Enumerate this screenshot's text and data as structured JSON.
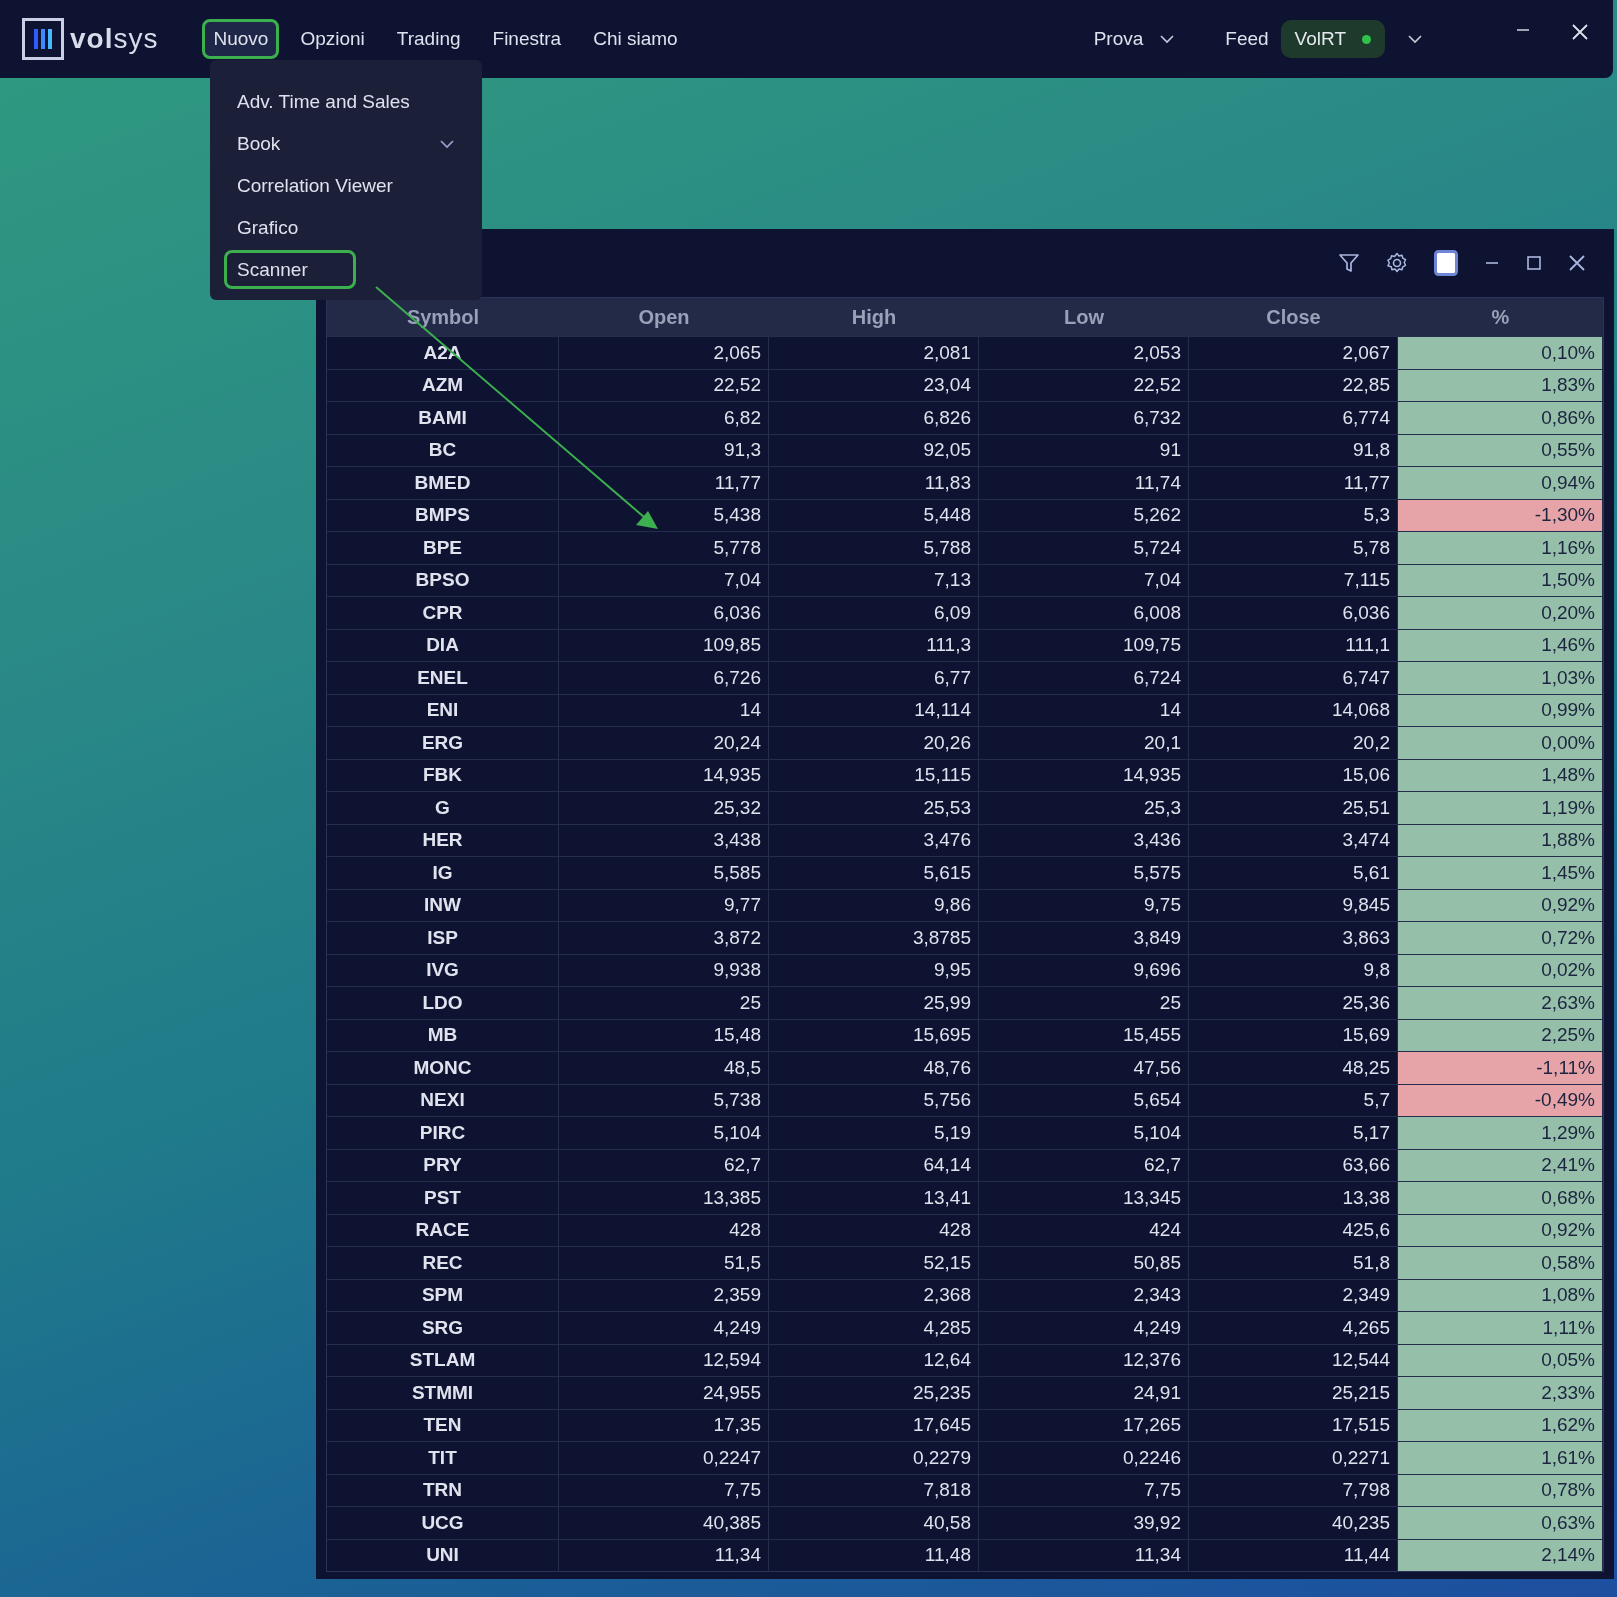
{
  "app": {
    "logo_text": "**vol**sys"
  },
  "menubar": [
    {
      "label": "Nuovo",
      "selected": true
    },
    {
      "label": "Opzioni",
      "selected": false
    },
    {
      "label": "Trading",
      "selected": false
    },
    {
      "label": "Finestra",
      "selected": false
    },
    {
      "label": "Chi siamo",
      "selected": false
    }
  ],
  "profile": {
    "label": "Prova"
  },
  "feed": {
    "label": "Feed",
    "source": "VolRT",
    "connected": true
  },
  "dropdown": [
    {
      "label": "Adv. Time and Sales",
      "kind": "item",
      "selected": false
    },
    {
      "label": "Book",
      "kind": "submenu",
      "selected": false
    },
    {
      "label": "Correlation Viewer",
      "kind": "item",
      "selected": false
    },
    {
      "label": "Grafico",
      "kind": "item",
      "selected": false
    },
    {
      "label": "Scanner",
      "kind": "item",
      "selected": true
    }
  ],
  "scanner": {
    "columns": [
      "Symbol",
      "Open",
      "High",
      "Low",
      "Close",
      "%"
    ],
    "rows": [
      {
        "cells": [
          "A2A",
          "2,065",
          "2,081",
          "2,053",
          "2,067",
          "0,10%"
        ],
        "negative": false
      },
      {
        "cells": [
          "AZM",
          "22,52",
          "23,04",
          "22,52",
          "22,85",
          "1,83%"
        ],
        "negative": false
      },
      {
        "cells": [
          "BAMI",
          "6,82",
          "6,826",
          "6,732",
          "6,774",
          "0,86%"
        ],
        "negative": false
      },
      {
        "cells": [
          "BC",
          "91,3",
          "92,05",
          "91",
          "91,8",
          "0,55%"
        ],
        "negative": false
      },
      {
        "cells": [
          "BMED",
          "11,77",
          "11,83",
          "11,74",
          "11,77",
          "0,94%"
        ],
        "negative": false
      },
      {
        "cells": [
          "BMPS",
          "5,438",
          "5,448",
          "5,262",
          "5,3",
          "-1,30%"
        ],
        "negative": true
      },
      {
        "cells": [
          "BPE",
          "5,778",
          "5,788",
          "5,724",
          "5,78",
          "1,16%"
        ],
        "negative": false
      },
      {
        "cells": [
          "BPSO",
          "7,04",
          "7,13",
          "7,04",
          "7,115",
          "1,50%"
        ],
        "negative": false
      },
      {
        "cells": [
          "CPR",
          "6,036",
          "6,09",
          "6,008",
          "6,036",
          "0,20%"
        ],
        "negative": false
      },
      {
        "cells": [
          "DIA",
          "109,85",
          "111,3",
          "109,75",
          "111,1",
          "1,46%"
        ],
        "negative": false
      },
      {
        "cells": [
          "ENEL",
          "6,726",
          "6,77",
          "6,724",
          "6,747",
          "1,03%"
        ],
        "negative": false
      },
      {
        "cells": [
          "ENI",
          "14",
          "14,114",
          "14",
          "14,068",
          "0,99%"
        ],
        "negative": false
      },
      {
        "cells": [
          "ERG",
          "20,24",
          "20,26",
          "20,1",
          "20,2",
          "0,00%"
        ],
        "negative": false
      },
      {
        "cells": [
          "FBK",
          "14,935",
          "15,115",
          "14,935",
          "15,06",
          "1,48%"
        ],
        "negative": false
      },
      {
        "cells": [
          "G",
          "25,32",
          "25,53",
          "25,3",
          "25,51",
          "1,19%"
        ],
        "negative": false
      },
      {
        "cells": [
          "HER",
          "3,438",
          "3,476",
          "3,436",
          "3,474",
          "1,88%"
        ],
        "negative": false
      },
      {
        "cells": [
          "IG",
          "5,585",
          "5,615",
          "5,575",
          "5,61",
          "1,45%"
        ],
        "negative": false
      },
      {
        "cells": [
          "INW",
          "9,77",
          "9,86",
          "9,75",
          "9,845",
          "0,92%"
        ],
        "negative": false
      },
      {
        "cells": [
          "ISP",
          "3,872",
          "3,8785",
          "3,849",
          "3,863",
          "0,72%"
        ],
        "negative": false
      },
      {
        "cells": [
          "IVG",
          "9,938",
          "9,95",
          "9,696",
          "9,8",
          "0,02%"
        ],
        "negative": false
      },
      {
        "cells": [
          "LDO",
          "25",
          "25,99",
          "25",
          "25,36",
          "2,63%"
        ],
        "negative": false
      },
      {
        "cells": [
          "MB",
          "15,48",
          "15,695",
          "15,455",
          "15,69",
          "2,25%"
        ],
        "negative": false
      },
      {
        "cells": [
          "MONC",
          "48,5",
          "48,76",
          "47,56",
          "48,25",
          "-1,11%"
        ],
        "negative": true
      },
      {
        "cells": [
          "NEXI",
          "5,738",
          "5,756",
          "5,654",
          "5,7",
          "-0,49%"
        ],
        "negative": true
      },
      {
        "cells": [
          "PIRC",
          "5,104",
          "5,19",
          "5,104",
          "5,17",
          "1,29%"
        ],
        "negative": false
      },
      {
        "cells": [
          "PRY",
          "62,7",
          "64,14",
          "62,7",
          "63,66",
          "2,41%"
        ],
        "negative": false
      },
      {
        "cells": [
          "PST",
          "13,385",
          "13,41",
          "13,345",
          "13,38",
          "0,68%"
        ],
        "negative": false
      },
      {
        "cells": [
          "RACE",
          "428",
          "428",
          "424",
          "425,6",
          "0,92%"
        ],
        "negative": false
      },
      {
        "cells": [
          "REC",
          "51,5",
          "52,15",
          "50,85",
          "51,8",
          "0,58%"
        ],
        "negative": false
      },
      {
        "cells": [
          "SPM",
          "2,359",
          "2,368",
          "2,343",
          "2,349",
          "1,08%"
        ],
        "negative": false
      },
      {
        "cells": [
          "SRG",
          "4,249",
          "4,285",
          "4,249",
          "4,265",
          "1,11%"
        ],
        "negative": false
      },
      {
        "cells": [
          "STLAM",
          "12,594",
          "12,64",
          "12,376",
          "12,544",
          "0,05%"
        ],
        "negative": false
      },
      {
        "cells": [
          "STMMI",
          "24,955",
          "25,235",
          "24,91",
          "25,215",
          "2,33%"
        ],
        "negative": false
      },
      {
        "cells": [
          "TEN",
          "17,35",
          "17,645",
          "17,265",
          "17,515",
          "1,62%"
        ],
        "negative": false
      },
      {
        "cells": [
          "TIT",
          "0,2247",
          "0,2279",
          "0,2246",
          "0,2271",
          "1,61%"
        ],
        "negative": false
      },
      {
        "cells": [
          "TRN",
          "7,75",
          "7,818",
          "7,75",
          "7,798",
          "0,78%"
        ],
        "negative": false
      },
      {
        "cells": [
          "UCG",
          "40,385",
          "40,58",
          "39,92",
          "40,235",
          "0,63%"
        ],
        "negative": false
      },
      {
        "cells": [
          "UNI",
          "11,34",
          "11,48",
          "11,34",
          "11,44",
          "2,14%"
        ],
        "negative": false
      }
    ]
  }
}
